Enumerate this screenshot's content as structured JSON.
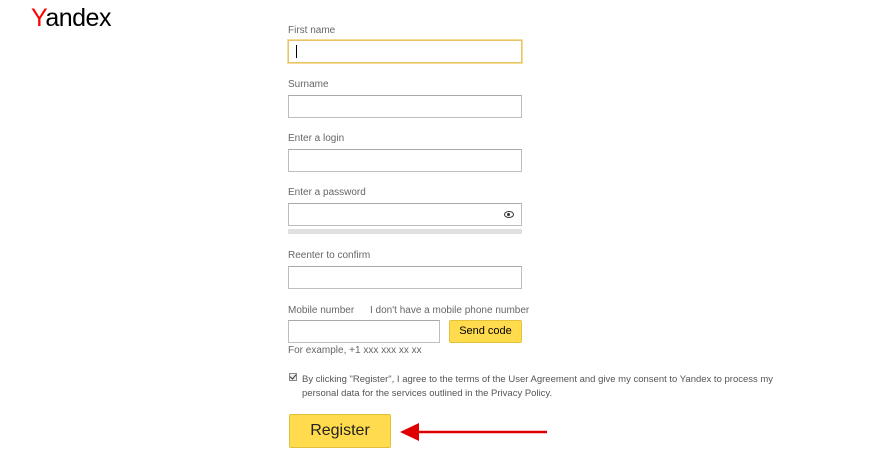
{
  "logo": {
    "first": "Y",
    "rest": "andex"
  },
  "form": {
    "first_name_label": "First name",
    "surname_label": "Surname",
    "login_label": "Enter a login",
    "password_label": "Enter a password",
    "confirm_label": "Reenter to confirm",
    "mobile_label": "Mobile number",
    "no_phone_link": "I don't have a mobile phone number",
    "send_code": "Send code",
    "phone_hint": "For example, +1 xxx xxx xx xx",
    "terms": "By clicking \"Register\", I agree to the terms of the User Agreement and give my consent to Yandex to process my personal data for the services outlined in the Privacy Policy.",
    "register": "Register"
  },
  "colors": {
    "accent": "#ffdb4d",
    "arrow": "#e00000",
    "brand_red": "#ff0000"
  }
}
